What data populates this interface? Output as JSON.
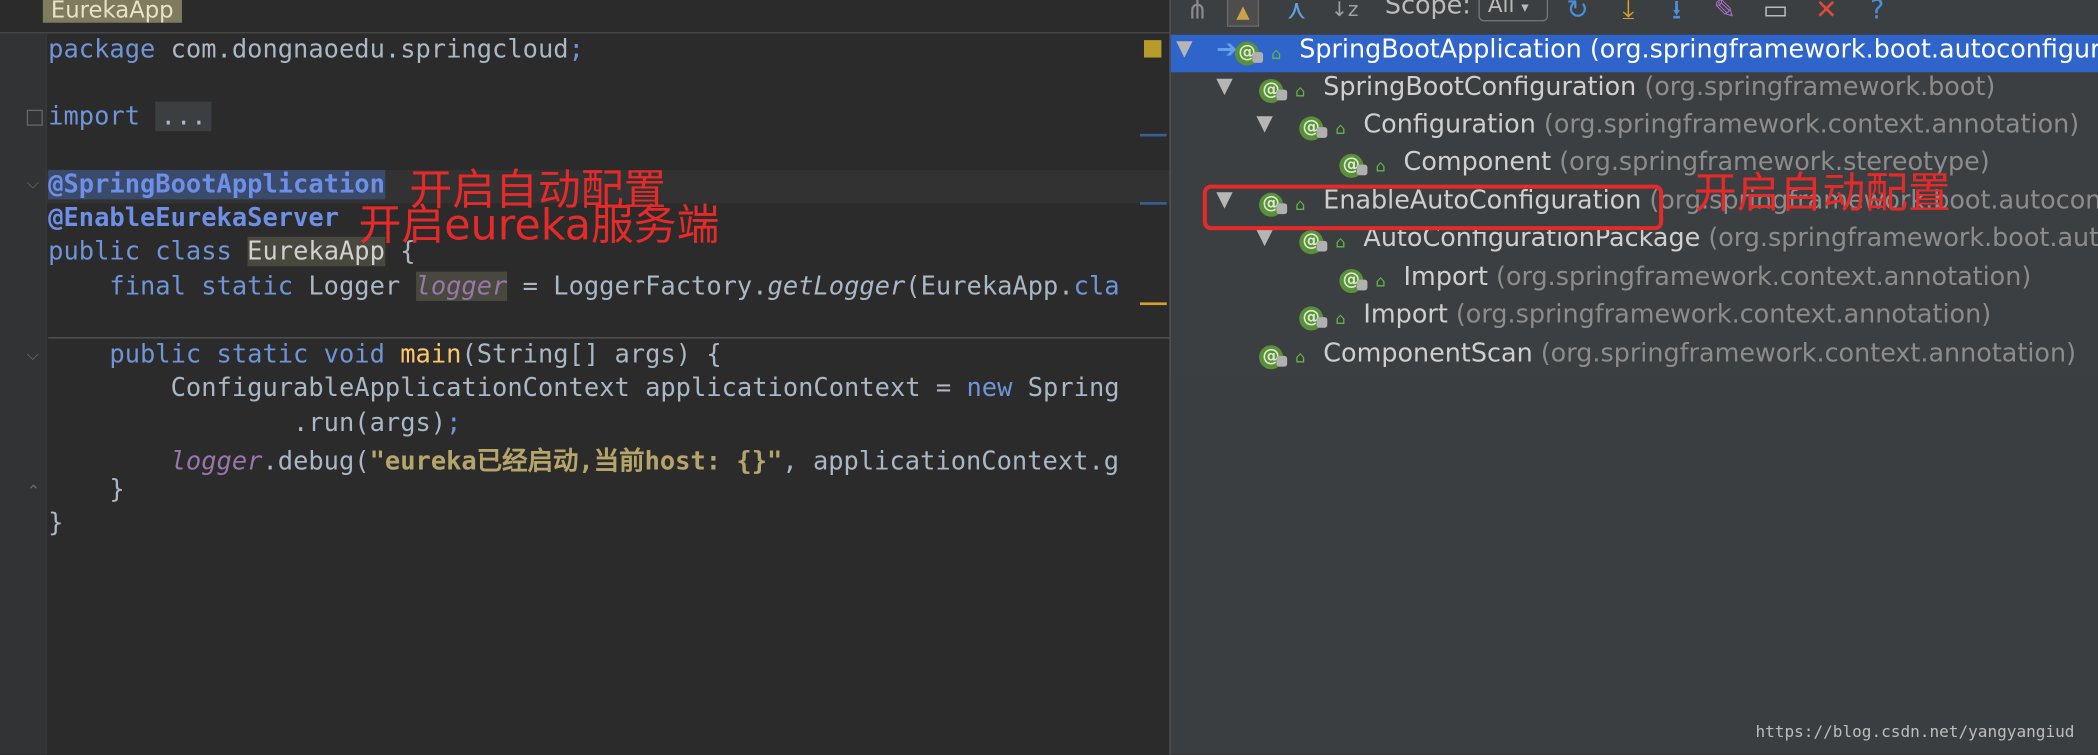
{
  "editor": {
    "tab_title": "EurekaApp",
    "line1_kw": "package",
    "line1_pkg": " com.dongnaoedu.springcloud",
    "line1_end": ";",
    "line2_kw": "import",
    "line2_fold": "...",
    "line3_anno": "@SpringBootApplication",
    "line4_anno": "@EnableEurekaServer",
    "line5_kw": "public class",
    "line5_cls": "EurekaApp",
    "line5_end": " {",
    "line6_kw": "    final static",
    "line6_type": " Logger ",
    "line6_var": "logger",
    "line6_mid": " = LoggerFactory.",
    "line6_fn": "getLogger",
    "line6_end": "(EurekaApp.",
    "line6_cla": "cla",
    "line7_kw": "    public static void",
    "line7_fn": " main",
    "line7_end": "(String[] args) {",
    "line8_text": "        ConfigurableApplicationContext applicationContext = ",
    "line8_kw": "new",
    "line8_end": " Spring",
    "line9_text": "                .run(args)",
    "line9_end": ";",
    "line10_var": "        logger",
    "line10_mid": ".debug(",
    "line10_str": "\"eureka已经启动,当前host: {}\"",
    "line10_end": ", applicationContext.g",
    "line11_text": "    }",
    "line12_text": "}"
  },
  "notes": {
    "editor_note1": "开启自动配置",
    "editor_note2": "开启eureka服务端",
    "tree_note": "开启自动配置"
  },
  "hierarchy": {
    "scope_label": "Scope:",
    "scope_value": "All",
    "rows": [
      {
        "name": "SpringBootApplication",
        "pkg": " (org.springframework.boot.autoconfigure"
      },
      {
        "name": "SpringBootConfiguration",
        "pkg": " (org.springframework.boot)"
      },
      {
        "name": "Configuration",
        "pkg": " (org.springframework.context.annotation)"
      },
      {
        "name": "Component",
        "pkg": " (org.springframework.stereotype)"
      },
      {
        "name": "EnableAutoConfiguration",
        "pkg": " (org.springframework.boot.autoconf"
      },
      {
        "name": "AutoConfigurationPackage",
        "pkg": " (org.springframework.boot.auto"
      },
      {
        "name": "Import",
        "pkg": " (org.springframework.context.annotation)"
      },
      {
        "name": "Import",
        "pkg": " (org.springframework.context.annotation)"
      },
      {
        "name": "ComponentScan",
        "pkg": " (org.springframework.context.annotation)"
      }
    ]
  },
  "watermark": "https://blog.csdn.net/yangyangiud",
  "colors": {
    "editor_bg": "#2b2b2b",
    "panel_bg": "#3c3f41",
    "selection": "#2f65ca",
    "annotation_red": "#e62a2a"
  }
}
